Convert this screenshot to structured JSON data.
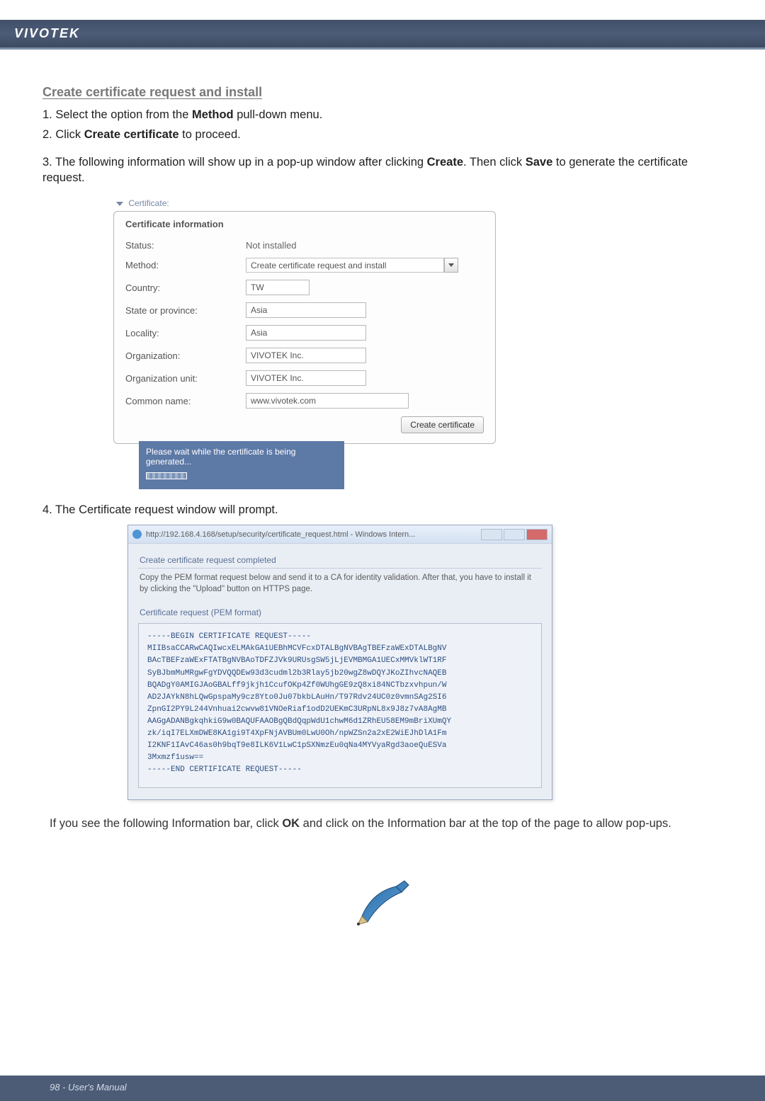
{
  "header": {
    "brand": "VIVOTEK"
  },
  "section_title": "Create certificate request and install",
  "steps": {
    "s1_prefix": "1. Select the option from the ",
    "s1_bold": "Method",
    "s1_suffix": " pull-down menu.",
    "s2_prefix": "2. Click ",
    "s2_bold": "Create certificate",
    "s2_suffix": " to proceed.",
    "s3_prefix": "3. The following information will show up in a pop-up window after clicking ",
    "s3_bold1": "Create",
    "s3_mid": ". Then click ",
    "s3_bold2": "Save",
    "s3_suffix": " to generate the certificate request.",
    "s4": "4. The Certificate request window will prompt."
  },
  "cert_panel": {
    "arrow_label": "Certificate:",
    "box_title": "Certificate information",
    "rows": {
      "status_label": "Status:",
      "status_value": "Not installed",
      "method_label": "Method:",
      "method_value": "Create certificate request and install",
      "country_label": "Country:",
      "country_value": "TW",
      "state_label": "State or province:",
      "state_value": "Asia",
      "locality_label": "Locality:",
      "locality_value": "Asia",
      "org_label": "Organization:",
      "org_value": "VIVOTEK Inc.",
      "orgunit_label": "Organization unit:",
      "orgunit_value": "VIVOTEK Inc.",
      "common_label": "Common name:",
      "common_value": "www.vivotek.com"
    },
    "create_button": "Create certificate",
    "wait_text": "Please wait while the certificate is being generated..."
  },
  "ie_window": {
    "title": "http://192.168.4.168/setup/security/certificate_request.html - Windows Intern...",
    "section_completed": "Create certificate request completed",
    "help_text": "Copy the PEM format request below and send it to a CA for identity validation. After that, you have to install it by clicking the \"Upload\" button on HTTPS page.",
    "request_label": "Certificate request (PEM format)",
    "pem": "-----BEGIN CERTIFICATE REQUEST-----\nMIIBsaCCARwCAQIwcxELMAkGA1UEBhMCVFcxDTALBgNVBAgTBEFzaWExDTALBgNV\nBAcTBEFzaWExFTATBgNVBAoTDFZJVk9URUsgSW5jLjEVMBMGA1UECxMMVklWT1RF\nSyBJbmMuMRgwFgYDVQQDEw93d3cudml2b3Rlay5jb20wgZ8wDQYJKoZIhvcNAQEB\nBQADgY0AMIGJAoGBALff9jkjh1CcufOKp4Zf0WUhgGE9zQ8xi84NCTbzxvhpun/W\nAD2JAYkN8hLQwGpspaMy9cz8Yto0Ju07bkbLAuHn/T97Rdv24UC0z0vmnSAg2SI6\nZpnGI2PY9L244Vnhuai2cwvw81VNOeRiaf1odD2UEKmC3URpNL8x9J8z7vA8AgMB\nAAGgADANBgkqhkiG9w0BAQUFAAOBgQBdQqpWdU1chwM6d1ZRhEU58EM9mBriXUmQY\nzk/iqI7ELXmDWE8KA1gi9T4XpFNjAVBUm0LwU0Oh/npWZSn2a2xE2WiEJhDlA1Fm\nI2KNF1IAvC46as0h9bqT9e8ILK6V1LwC1pSXNmzEu0qNa4MYVyaRgd3aoeQuESVa\n3Mxmzf1usw==\n-----END CERTIFICATE REQUEST-----"
  },
  "after_text": {
    "prefix": "If you see the following Information bar, click ",
    "bold": "OK",
    "suffix": " and click on the Information bar at the top of the page to allow pop-ups."
  },
  "footer": {
    "text": "98 - User's Manual"
  }
}
